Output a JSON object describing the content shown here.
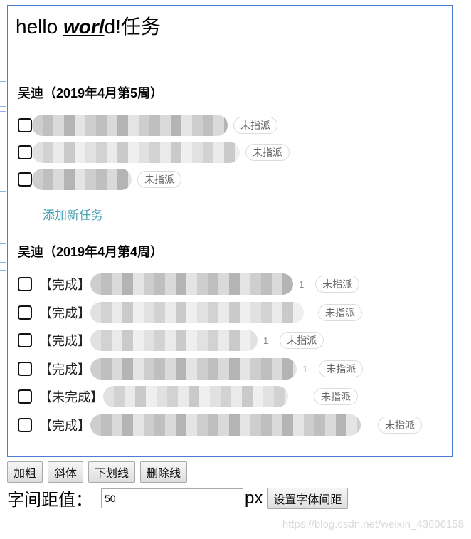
{
  "editor": {
    "title_parts": {
      "a": "hello ",
      "b": "worl",
      "c": "d!任务"
    },
    "groups": [
      {
        "title": "吴迪（2019年4月第5周）",
        "items": [
          {
            "status": "",
            "suffix": "",
            "tag": "未指派"
          },
          {
            "status": "",
            "suffix": "",
            "tag": "未指派"
          },
          {
            "status": "",
            "suffix": "",
            "tag": "未指派"
          }
        ],
        "add_task_label": "添加新任务"
      },
      {
        "title": "吴迪（2019年4月第4周）",
        "items": [
          {
            "status": "【完成】",
            "suffix": "1",
            "tag": "未指派"
          },
          {
            "status": "【完成】",
            "suffix": "",
            "tag": "未指派"
          },
          {
            "status": "【完成】",
            "suffix": "1",
            "tag": "未指派"
          },
          {
            "status": "【完成】",
            "suffix": "1",
            "tag": "未指派"
          },
          {
            "status": "【未完成】",
            "suffix": "",
            "tag": "未指派"
          },
          {
            "status": "【完成】",
            "suffix": "",
            "tag": "未指派"
          }
        ]
      }
    ]
  },
  "toolbar": {
    "bold_label": "加粗",
    "italic_label": "斜体",
    "underline_label": "下划线",
    "strike_label": "删除线"
  },
  "spacing": {
    "label": "字间距值：",
    "value": "50",
    "unit": "px",
    "button_label": "设置字体间距"
  },
  "watermark": "https://blog.csdn.net/weixin_43606158",
  "colors": {
    "editor_border": "#4a7fd0",
    "link": "#4aa3b5"
  }
}
